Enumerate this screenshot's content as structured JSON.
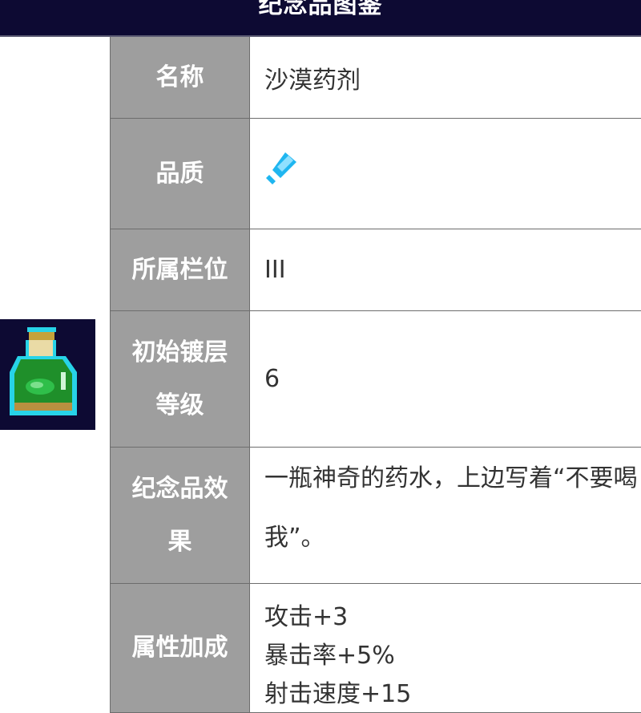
{
  "header": {
    "title": "纪念品图鉴"
  },
  "item_icon": {
    "name": "green-potion-bottle-icon"
  },
  "rows": [
    {
      "label": "名称",
      "value": "沙漠药剂"
    },
    {
      "label": "品质",
      "value_icon": "blue-quality-gem-icon"
    },
    {
      "label": "所属栏位",
      "value": "III"
    },
    {
      "label": "初始镀层等级",
      "value": "6"
    },
    {
      "label": "纪念品效果",
      "value": "一瓶神奇的药水，上边写着“不要喝我”。"
    },
    {
      "label": "属性加成",
      "values": [
        "攻击+3",
        "暴击率+5%",
        "射击速度+15"
      ]
    }
  ],
  "colors": {
    "header_bg": "#0d0a33",
    "label_bg": "#9e9e9e",
    "quality_gem": "#1fb6f0",
    "potion_liquid": "#1f8f2a",
    "potion_outline": "#27d3e8"
  }
}
